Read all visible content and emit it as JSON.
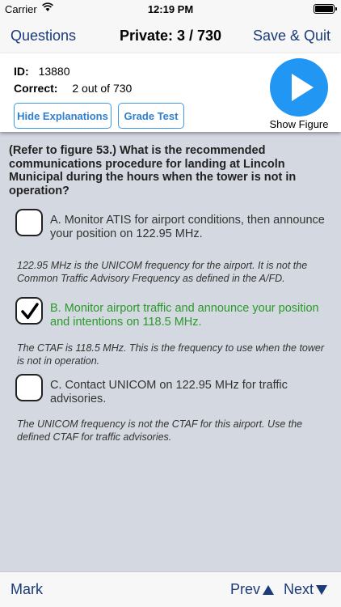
{
  "status_bar": {
    "carrier": "Carrier",
    "time": "12:19 PM"
  },
  "nav": {
    "left_label": "Questions",
    "title": "Private: 3 / 730",
    "right_label": "Save & Quit"
  },
  "header": {
    "id_label": "ID:",
    "id_value": "13880",
    "correct_label": "Correct:",
    "correct_value": "2 out of 730",
    "hide_explanations_label": "Hide Explanations",
    "grade_test_label": "Grade Test",
    "show_figure_label": "Show Figure"
  },
  "question": {
    "text": "(Refer to figure 53.) What is the recommended communications procedure for landing at Lincoln Municipal during the hours when the tower is not in operation?"
  },
  "answers": [
    {
      "text": "A.   Monitor ATIS for airport conditions, then announce your position on 122.95 MHz.",
      "checked": false,
      "explanation": "122.95 MHz is the UNICOM frequency for the airport.  It is not the Common Traffic Advisory Frequency as defined in the A/FD."
    },
    {
      "text": "B.   Monitor airport traffic and announce your position and intentions on 118.5 MHz.",
      "checked": true,
      "explanation": "The CTAF is 118.5 MHz.  This is the frequency to use when the tower is not in operation."
    },
    {
      "text": "C.   Contact UNICOM on 122.95 MHz for traffic advisories.",
      "checked": false,
      "explanation": "The UNICOM frequency is not the CTAF for this airport.  Use the defined CTAF for traffic advisories."
    }
  ],
  "toolbar": {
    "mark_label": "Mark",
    "prev_label": "Prev",
    "next_label": "Next"
  },
  "icons": {
    "wifi": "wifi-icon",
    "battery": "battery-icon",
    "play": "play-icon",
    "check": "checkmark-icon",
    "prev": "triangle-up-icon",
    "next": "triangle-down-icon"
  },
  "colors": {
    "accent_blue": "#2196f3",
    "nav_text": "#1a3a7a",
    "correct_green": "#2a9a2a",
    "background": "#d4d8e0"
  }
}
